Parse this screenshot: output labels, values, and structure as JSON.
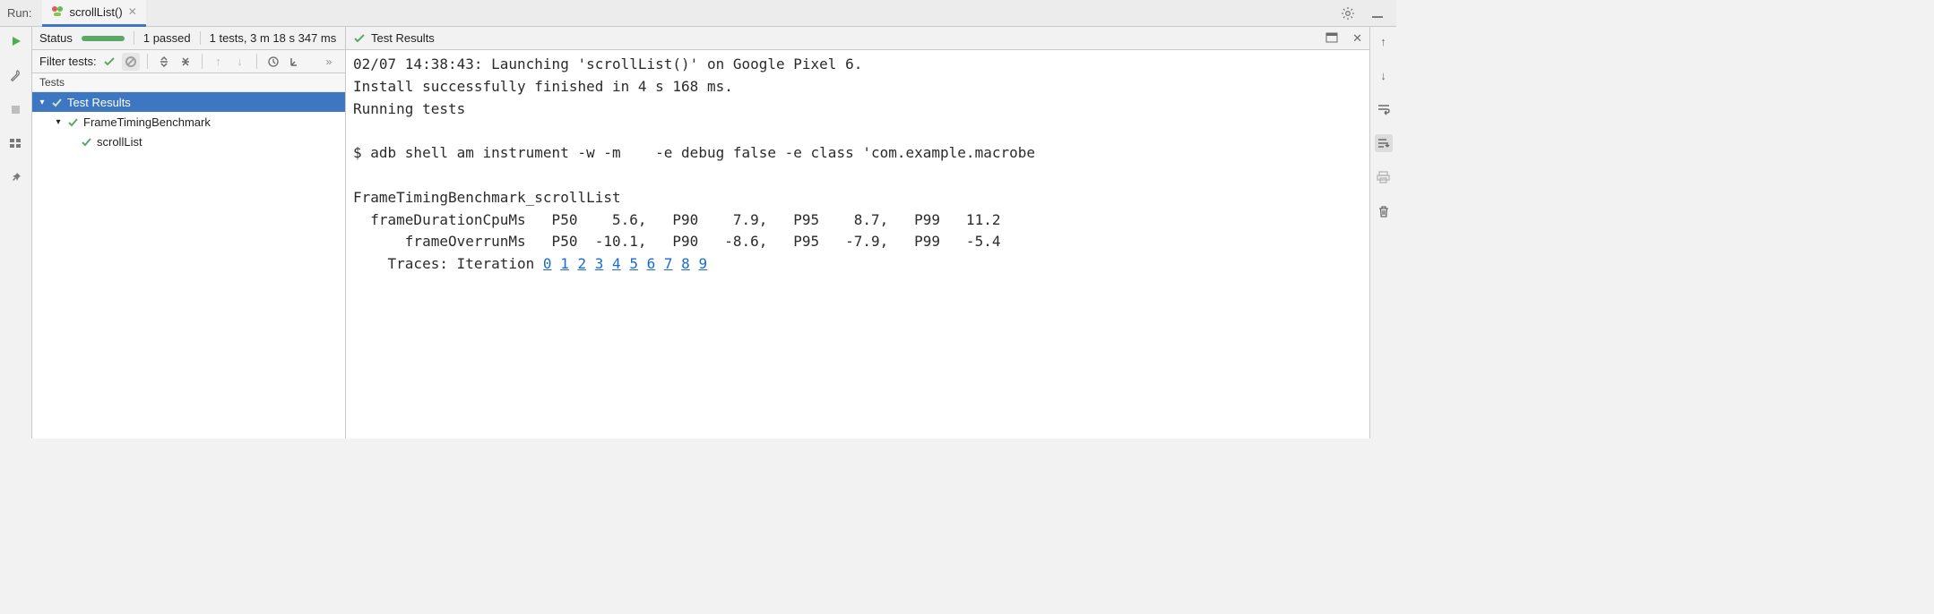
{
  "run": {
    "label": "Run:"
  },
  "tab": {
    "title": "scrollList()"
  },
  "status": {
    "label": "Status",
    "passed": "1 passed",
    "summary": "1 tests, 3 m 18 s 347 ms"
  },
  "filter": {
    "label": "Filter tests:"
  },
  "testsHeader": "Tests",
  "tree": {
    "root": "Test Results",
    "suite": "FrameTimingBenchmark",
    "test": "scrollList"
  },
  "outputHeader": "Test Results",
  "console": {
    "lines": [
      "02/07 14:38:43: Launching 'scrollList()' on Google Pixel 6.",
      "Install successfully finished in 4 s 168 ms.",
      "Running tests",
      "",
      "$ adb shell am instrument -w -m    -e debug false -e class 'com.example.macrobe",
      "",
      "FrameTimingBenchmark_scrollList",
      "  frameDurationCpuMs   P50    5.6,   P90    7.9,   P95    8.7,   P99   11.2",
      "      frameOverrunMs   P50  -10.1,   P90   -8.6,   P95   -7.9,   P99   -5.4",
      "    Traces: Iteration "
    ],
    "traceLinks": [
      "0",
      "1",
      "2",
      "3",
      "4",
      "5",
      "6",
      "7",
      "8",
      "9"
    ]
  }
}
